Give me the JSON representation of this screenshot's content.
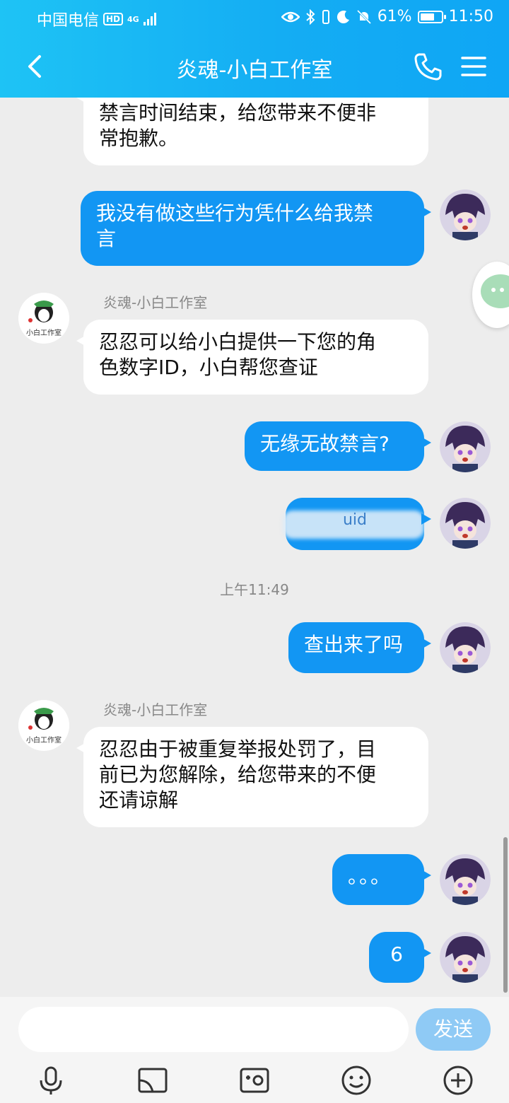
{
  "status_bar": {
    "carrier": "中国电信",
    "network": "4G",
    "hd": "HD",
    "battery": "61%",
    "time": "11:50"
  },
  "header": {
    "title": "炎魂-小白工作室",
    "icons": [
      "back-arrow-icon",
      "phone-icon",
      "menu-icon"
    ]
  },
  "messages": [
    {
      "side": "left",
      "text": "禁言时间结束，给您带来不便非"
    },
    {
      "side": "left",
      "text": "常抱歉。"
    },
    {
      "side": "right",
      "line1": "我没有做这些行为凭什么给我禁",
      "line2": "言"
    },
    {
      "side": "left",
      "sender": "炎魂-小白工作室",
      "line1": "忍忍可以给小白提供一下您的角",
      "line2": "色数字ID，小白帮您查证"
    },
    {
      "side": "right",
      "text": "无缘无故禁言?"
    },
    {
      "side": "right",
      "text": "uid"
    },
    {
      "side": "right",
      "text": "查出来了吗"
    },
    {
      "side": "left",
      "sender": "炎魂-小白工作室",
      "line1": "忍忍由于被重复举报处罚了，目",
      "line2": "前已为您解除，给您带来的不便",
      "line3": "还请谅解"
    },
    {
      "side": "right",
      "text": "。。。"
    },
    {
      "side": "right",
      "text": "6"
    }
  ],
  "timestamp": "上午11:49",
  "avatar_caption": "小白工作室",
  "composer": {
    "send_label": "发送",
    "tools": [
      "microphone-icon",
      "screen-cast-icon",
      "camera-icon",
      "emoji-icon",
      "plus-icon"
    ]
  }
}
